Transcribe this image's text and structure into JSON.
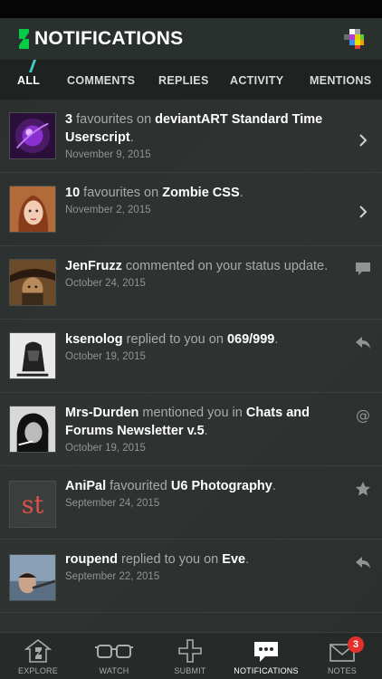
{
  "header": {
    "title": "NOTIFICATIONS"
  },
  "tabs": [
    {
      "label": "ALL"
    },
    {
      "label": "COMMENTS"
    },
    {
      "label": "REPLIES"
    },
    {
      "label": "ACTIVITY"
    },
    {
      "label": "MENTIONS"
    }
  ],
  "notifications": [
    {
      "actor": "3",
      "verb": " favourites on ",
      "target": "deviantART Standard Time Userscript",
      "tail": ".",
      "date": "November 9, 2015",
      "icon": "chevron-right-icon"
    },
    {
      "actor": "10",
      "verb": " favourites on ",
      "target": "Zombie CSS",
      "tail": ".",
      "date": "November 2, 2015",
      "icon": "chevron-right-icon"
    },
    {
      "actor": "JenFruzz",
      "verb": " commented on your status update.",
      "target": "",
      "tail": "",
      "date": "October 24, 2015",
      "icon": "comment-bubble-icon"
    },
    {
      "actor": "ksenolog",
      "verb": " replied to you on ",
      "target": "069/999",
      "tail": ".",
      "date": "October 19, 2015",
      "icon": "reply-arrow-icon"
    },
    {
      "actor": "Mrs-Durden",
      "verb": " mentioned you in ",
      "target": "Chats and Forums Newsletter v.5",
      "tail": ".",
      "date": "October 19, 2015",
      "icon": "at-sign-icon"
    },
    {
      "actor": "AniPal",
      "verb": " favourited ",
      "target": "U6 Photography",
      "tail": ".",
      "date": "September 24, 2015",
      "icon": "star-icon"
    },
    {
      "actor": "roupend",
      "verb": " replied to you on ",
      "target": "Eve",
      "tail": ".",
      "date": "September 22, 2015",
      "icon": "reply-arrow-icon"
    }
  ],
  "bottom_nav": [
    {
      "label": "EXPLORE"
    },
    {
      "label": "WATCH"
    },
    {
      "label": "SUBMIT"
    },
    {
      "label": "NOTIFICATIONS"
    },
    {
      "label": "NOTES",
      "badge": "3"
    }
  ],
  "colors": {
    "accent": "#05cc47",
    "badge": "#e4302d",
    "header_bg": "#2a302e",
    "tabs_bg": "#1e2322"
  }
}
